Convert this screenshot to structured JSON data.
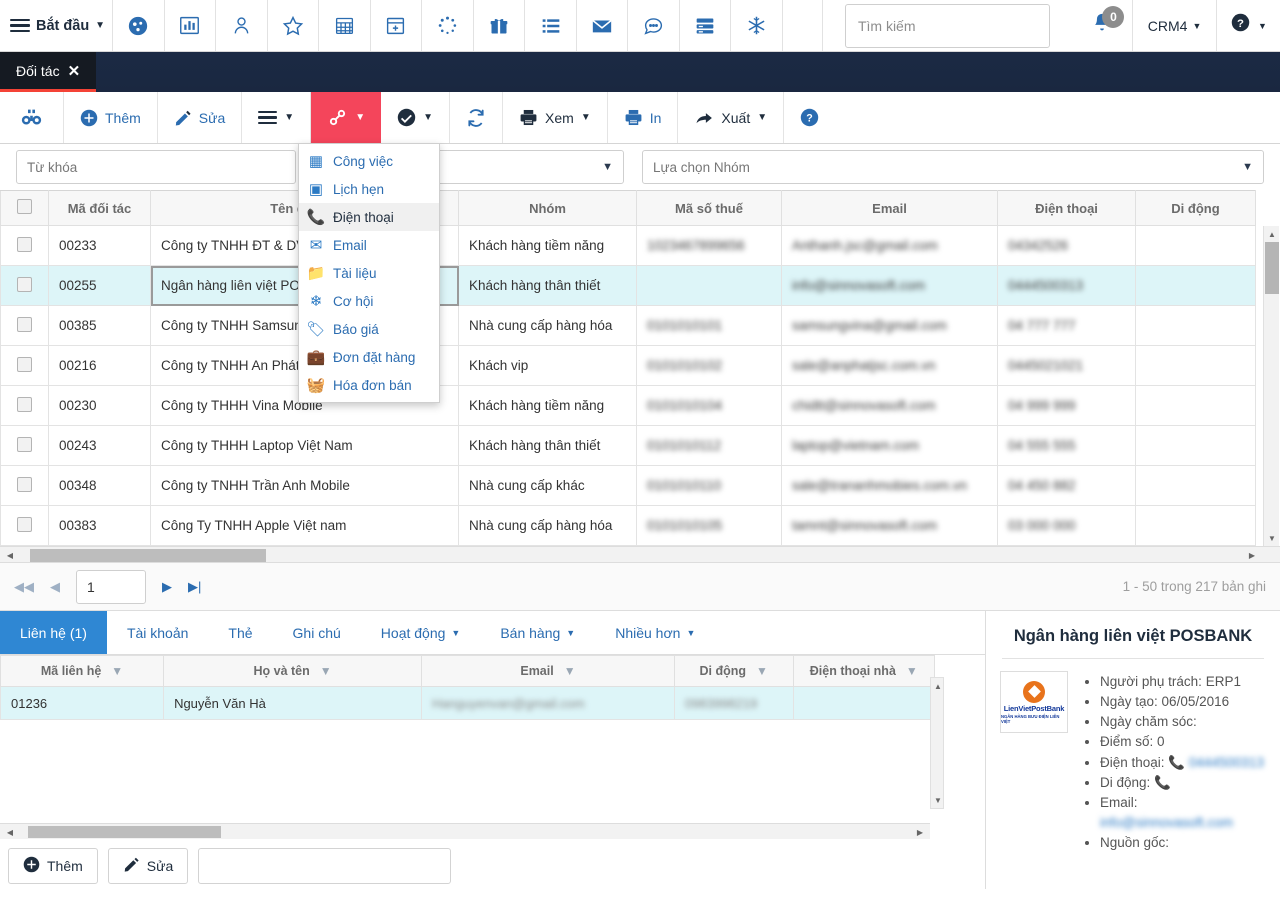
{
  "topnav": {
    "start_label": "Bắt đầu",
    "icons": [
      {
        "name": "dashboard-icon",
        "glyph": "◕"
      },
      {
        "name": "chart-icon",
        "glyph": "▥"
      },
      {
        "name": "contact-icon",
        "glyph": "👤"
      },
      {
        "name": "star-icon",
        "glyph": "☆"
      },
      {
        "name": "calendar-icon",
        "glyph": "▦"
      },
      {
        "name": "calendar-add-icon",
        "glyph": "▣"
      },
      {
        "name": "loading-icon",
        "glyph": "◌"
      },
      {
        "name": "gift-icon",
        "glyph": "🎁"
      },
      {
        "name": "list-icon",
        "glyph": "☰"
      },
      {
        "name": "mail-icon",
        "glyph": "✉"
      },
      {
        "name": "chat-icon",
        "glyph": "💬"
      },
      {
        "name": "server-icon",
        "glyph": "▤"
      },
      {
        "name": "snowflake-icon",
        "glyph": "❄"
      }
    ],
    "search_placeholder": "Tìm kiếm",
    "notification_count": "0",
    "user_label": "CRM4"
  },
  "apptab": {
    "label": "Đối tác",
    "close": "✕"
  },
  "toolbar": {
    "buttons": [
      {
        "name": "search-button",
        "label": "",
        "icon": "🔍"
      },
      {
        "name": "add-button",
        "label": "Thêm",
        "icon": "⊕"
      },
      {
        "name": "edit-button",
        "label": "Sửa",
        "icon": "✎"
      },
      {
        "name": "menu-button",
        "label": "",
        "icon": "☰"
      },
      {
        "name": "link-button",
        "label": "",
        "icon": "🔗"
      },
      {
        "name": "check-button",
        "label": "",
        "icon": "✔"
      },
      {
        "name": "refresh-button",
        "label": "",
        "icon": "⟳"
      },
      {
        "name": "view-button",
        "label": "Xem",
        "icon": "🖨"
      },
      {
        "name": "print-button",
        "label": "In",
        "icon": "🖨"
      },
      {
        "name": "export-button",
        "label": "Xuất",
        "icon": "➦"
      },
      {
        "name": "help-button",
        "label": "",
        "icon": "?"
      }
    ]
  },
  "context_menu": {
    "items": [
      {
        "label": "Công việc",
        "icon": "▦",
        "hover": false
      },
      {
        "label": "Lịch hẹn",
        "icon": "▣",
        "hover": false
      },
      {
        "label": "Điện thoại",
        "icon": "📞",
        "hover": true
      },
      {
        "label": "Email",
        "icon": "✉",
        "hover": false
      },
      {
        "label": "Tài liệu",
        "icon": "📁",
        "hover": false
      },
      {
        "label": "Cơ hội",
        "icon": "❄",
        "hover": false
      },
      {
        "label": "Báo giá",
        "icon": "🏷",
        "hover": false
      },
      {
        "label": "Đơn đặt hàng",
        "icon": "💼",
        "hover": false
      },
      {
        "label": "Hóa đơn bán",
        "icon": "🧺",
        "hover": false
      }
    ]
  },
  "filters": {
    "keyword_placeholder": "Từ khóa",
    "select_value": "",
    "group_placeholder": "Lựa chọn Nhóm"
  },
  "grid": {
    "headers": [
      "Mã đối tác",
      "Tên đối tác",
      "Nhóm",
      "Mã số thuế",
      "Email",
      "Điện thoại",
      "Di động"
    ],
    "rows": [
      {
        "code": "00233",
        "name": "Công ty TNHH ĐT & DV",
        "group": "Khách hàng tiềm năng",
        "tax": "1023467899656",
        "email": "Anthanh.jsc@gmail.com",
        "phone": "04342526",
        "mobile": "",
        "selected": false
      },
      {
        "code": "00255",
        "name": "Ngân hàng liên việt POSBANK",
        "group": "Khách hàng thân thiết",
        "tax": "",
        "email": "info@sinnovasoft.com",
        "phone": "0444500313",
        "mobile": "",
        "selected": true
      },
      {
        "code": "00385",
        "name": "Công ty TNHH Samsung",
        "group": "Nhà cung cấp hàng hóa",
        "tax": "0101010101",
        "email": "samsungvina@gmail.com",
        "phone": "04 777 777",
        "mobile": "",
        "selected": false
      },
      {
        "code": "00216",
        "name": "Công ty TNHH An Phát",
        "group": "Khách vip",
        "tax": "0101010102",
        "email": "sale@anphatjsc.com.vn",
        "phone": "0445021021",
        "mobile": "",
        "selected": false
      },
      {
        "code": "00230",
        "name": "Công ty THHH Vina Mobile",
        "group": "Khách hàng tiềm năng",
        "tax": "0101010104",
        "email": "chidtt@sinnovasoft.com",
        "phone": "04 999 999",
        "mobile": "",
        "selected": false
      },
      {
        "code": "00243",
        "name": "Công ty THHH Laptop Việt Nam",
        "group": "Khách hàng thân thiết",
        "tax": "0101010112",
        "email": "laptop@vietnam.com",
        "phone": "04 555 555",
        "mobile": "",
        "selected": false
      },
      {
        "code": "00348",
        "name": "Công ty TNHH Trần Anh Mobile",
        "group": "Nhà cung cấp khác",
        "tax": "0101010110",
        "email": "sale@trananhmobies.com.vn",
        "phone": "04 450 882",
        "mobile": "",
        "selected": false
      },
      {
        "code": "00383",
        "name": "Công Ty TNHH Apple Việt nam",
        "group": "Nhà cung cấp hàng hóa",
        "tax": "0101010105",
        "email": "tamnt@sinnovasoft.com",
        "phone": "03 000 000",
        "mobile": "",
        "selected": false
      }
    ]
  },
  "pager": {
    "page": "1",
    "count_text": "1 - 50 trong 217 bản ghi"
  },
  "subtabs": [
    {
      "label": "Liên hệ (1)",
      "active": true,
      "caret": false
    },
    {
      "label": "Tài khoản",
      "active": false,
      "caret": false
    },
    {
      "label": "Thẻ",
      "active": false,
      "caret": false
    },
    {
      "label": "Ghi chú",
      "active": false,
      "caret": false
    },
    {
      "label": "Hoạt động",
      "active": false,
      "caret": true
    },
    {
      "label": "Bán hàng",
      "active": false,
      "caret": true
    },
    {
      "label": "Nhiều hơn",
      "active": false,
      "caret": true
    }
  ],
  "subgrid": {
    "headers": [
      "Mã liên hệ",
      "Họ và tên",
      "Email",
      "Di động",
      "Điện thoại nhà"
    ],
    "rows": [
      {
        "code": "01236",
        "fullname": "Nguyễn Văn Hà",
        "email": "Hanguyenvan@gmail.com",
        "mobile": "0983998219",
        "home": ""
      }
    ]
  },
  "bottom_actions": {
    "add_label": "Thêm",
    "edit_label": "Sửa"
  },
  "detail_panel": {
    "title": "Ngân hàng liên việt POSBANK",
    "logo_line1": "LienVietPostBank",
    "logo_line2": "NGÂN HÀNG BƯU ĐIỆN LIÊN VIỆT",
    "fields": [
      {
        "label": "Người phụ trách:",
        "value": "ERP1",
        "blur": false,
        "phone": false
      },
      {
        "label": "Ngày tạo:",
        "value": "06/05/2016",
        "blur": false,
        "phone": false
      },
      {
        "label": "Ngày chăm sóc:",
        "value": "",
        "blur": false,
        "phone": false
      },
      {
        "label": "Điểm số:",
        "value": "0",
        "blur": false,
        "phone": false
      },
      {
        "label": "Điện thoại:",
        "value": "0444500313",
        "blur": true,
        "phone": true
      },
      {
        "label": "Di động:",
        "value": "",
        "blur": true,
        "phone": true
      },
      {
        "label": "Email:",
        "value": "info@sinnovasoft.com",
        "blur": true,
        "phone": false
      },
      {
        "label": "Nguồn gốc:",
        "value": "",
        "blur": false,
        "phone": false
      }
    ]
  },
  "colors": {
    "accent": "#2b6cb0",
    "danger": "#f4455b",
    "tab_active": "#2f87d3",
    "row_select": "#ddf5f8"
  }
}
